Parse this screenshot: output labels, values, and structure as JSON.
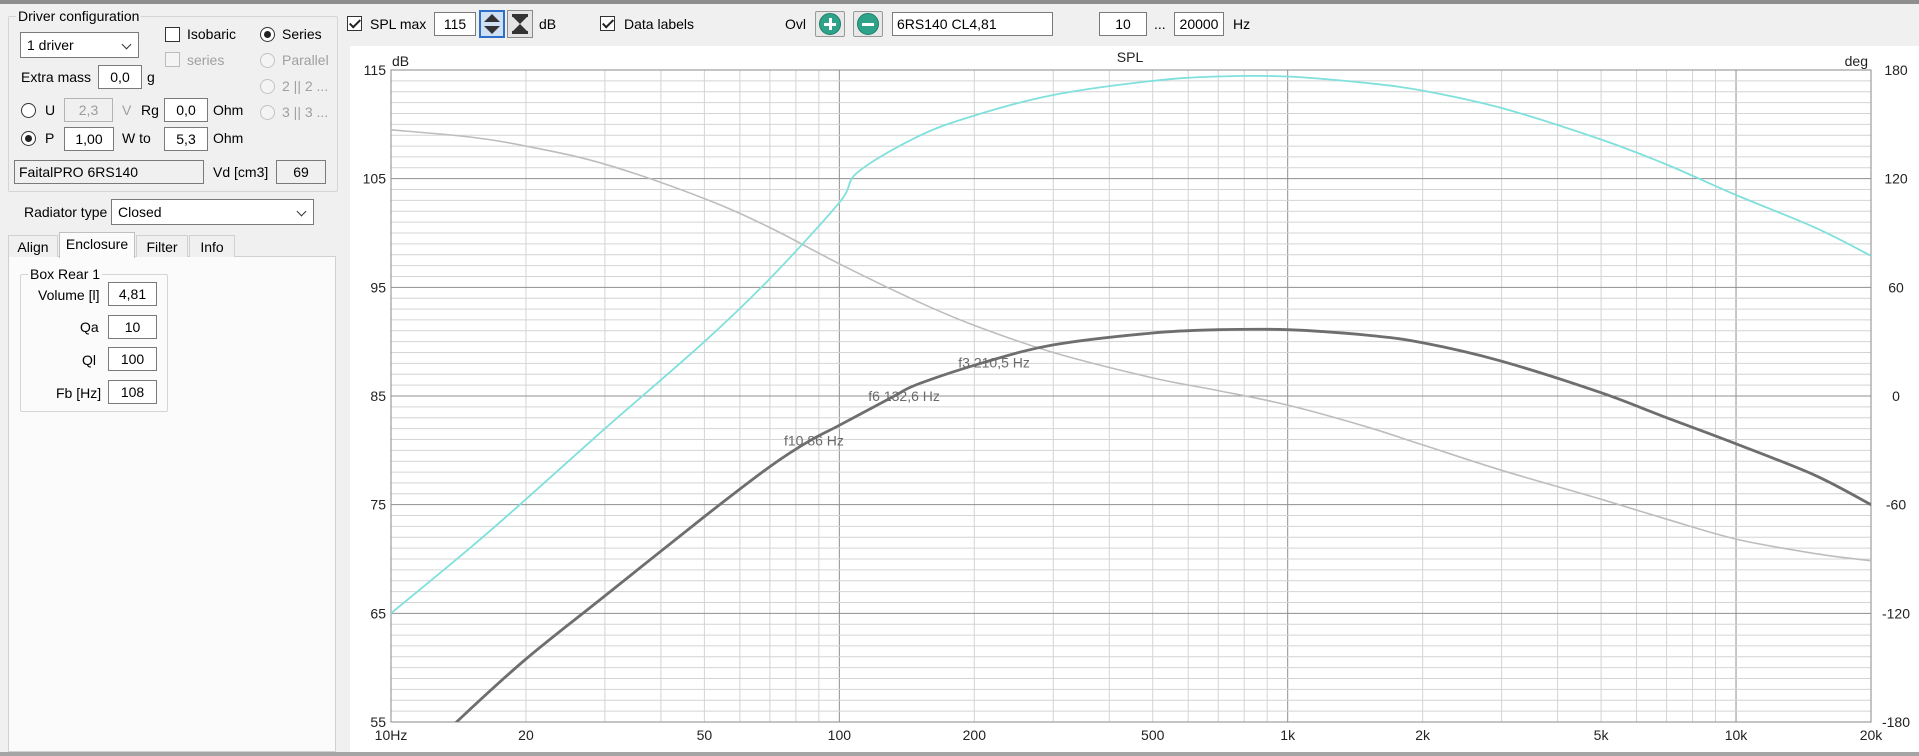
{
  "left_panel": {
    "driver_config_title": "Driver configuration",
    "driver_count": "1 driver",
    "isobaric_label": "Isobaric",
    "series_sub_label": "series",
    "series_label": "Series",
    "parallel_label": "Parallel",
    "two_par_label": "2 || 2 ...",
    "three_par_label": "3 || 3 ...",
    "extra_mass_label": "Extra mass",
    "extra_mass_value": "0,0",
    "extra_mass_unit": "g",
    "u_label": "U",
    "u_value": "2,3",
    "u_unit": "V",
    "rg_label": "Rg",
    "rg_value": "0,0",
    "rg_unit": "Ohm",
    "p_label": "P",
    "p_value": "1,00",
    "wto_label": "W to",
    "wto_value": "5,3",
    "wto_unit": "Ohm",
    "driver_name": "FaitalPRO 6RS140",
    "vd_label": "Vd [cm3]",
    "vd_value": "69",
    "radiator_type_label": "Radiator type",
    "radiator_type_value": "Closed",
    "tabs": [
      {
        "label": "Align"
      },
      {
        "label": "Enclosure"
      },
      {
        "label": "Filter"
      },
      {
        "label": "Info"
      }
    ],
    "box_title": "Box Rear 1",
    "volume_label": "Volume [l]",
    "volume_value": "4,81",
    "qa_label": "Qa",
    "qa_value": "10",
    "ql_label": "Ql",
    "ql_value": "100",
    "fb_label": "Fb [Hz]",
    "fb_value": "108"
  },
  "toolbar": {
    "spl_max_label": "SPL max",
    "spl_max_value": "115",
    "db_unit": "dB",
    "data_labels_label": "Data labels",
    "ovl_label": "Ovl",
    "ovl_name": "6RS140 CL4,81",
    "freq_min": "10",
    "range_sep": "...",
    "freq_max": "20000",
    "hz_unit": "Hz"
  },
  "colors": {
    "spl": "#6e6e6e",
    "phase": "#bdbdbd",
    "overlay": "#7fe0dc",
    "grid_major": "#8f8f8f",
    "grid_minor": "#d4d4d4",
    "accent_button": "#2fa38a"
  },
  "chart_data": {
    "type": "line",
    "title": "SPL",
    "ylabel_left": "dB",
    "ylabel_right": "deg",
    "x_scale": "log",
    "xlim": [
      10,
      20000
    ],
    "ylim": [
      55,
      115
    ],
    "ylim_right": [
      -180,
      180
    ],
    "grid": true,
    "x_ticks": [
      {
        "v": 10,
        "label": "10Hz"
      },
      {
        "v": 20,
        "label": "20"
      },
      {
        "v": 50,
        "label": "50"
      },
      {
        "v": 100,
        "label": "100"
      },
      {
        "v": 200,
        "label": "200"
      },
      {
        "v": 500,
        "label": "500"
      },
      {
        "v": 1000,
        "label": "1k"
      },
      {
        "v": 2000,
        "label": "2k"
      },
      {
        "v": 5000,
        "label": "5k"
      },
      {
        "v": 10000,
        "label": "10k"
      },
      {
        "v": 20000,
        "label": "20k"
      }
    ],
    "y_ticks": [
      115,
      105,
      95,
      85,
      75,
      65,
      55
    ],
    "y_ticks_right": [
      180,
      120,
      60,
      0,
      -60,
      -120,
      -180
    ],
    "series": [
      {
        "key": "spl",
        "x": [
          10,
          14,
          20,
          30,
          50,
          70,
          86,
          100,
          132.6,
          150,
          210.5,
          300,
          500,
          700,
          1000,
          1500,
          2000,
          3000,
          5000,
          7000,
          10000,
          15000,
          20000
        ],
        "y": [
          49.2,
          55.0,
          60.8,
          66.6,
          73.9,
          78.5,
          80.9,
          82.3,
          85.0,
          86.1,
          88.1,
          89.7,
          90.8,
          91.1,
          91.1,
          90.6,
          89.9,
          88.2,
          85.3,
          83.0,
          80.6,
          77.7,
          75.0
        ]
      },
      {
        "key": "phase",
        "x": [
          10,
          15,
          20,
          30,
          50,
          70,
          100,
          150,
          200,
          300,
          500,
          700,
          1000,
          1500,
          2000,
          3000,
          5000,
          7000,
          10000,
          15000,
          20000
        ],
        "y": [
          147,
          143,
          138,
          128,
          109,
          93,
          73,
          52,
          39,
          24,
          10,
          3,
          -5,
          -17,
          -27,
          -41,
          -57,
          -68,
          -79,
          -87,
          -91
        ]
      },
      {
        "key": "overlay",
        "x": [
          10,
          15,
          20,
          30,
          50,
          70,
          100,
          110,
          150,
          200,
          300,
          500,
          700,
          1000,
          1500,
          2000,
          3000,
          5000,
          7000,
          10000,
          15000,
          20000
        ],
        "y": [
          65.0,
          71.0,
          75.5,
          82.0,
          90.0,
          95.8,
          102.8,
          105.6,
          108.9,
          110.8,
          112.7,
          114.0,
          114.4,
          114.4,
          113.8,
          113.1,
          111.5,
          108.6,
          106.3,
          103.5,
          100.5,
          97.9
        ]
      }
    ],
    "annotations": [
      {
        "x": 86,
        "y": 80.9,
        "label": "f10 86 Hz"
      },
      {
        "x": 132.6,
        "y": 85.0,
        "label": "f6 132,6 Hz"
      },
      {
        "x": 210.5,
        "y": 88.1,
        "label": "f3 210,5 Hz"
      }
    ]
  }
}
